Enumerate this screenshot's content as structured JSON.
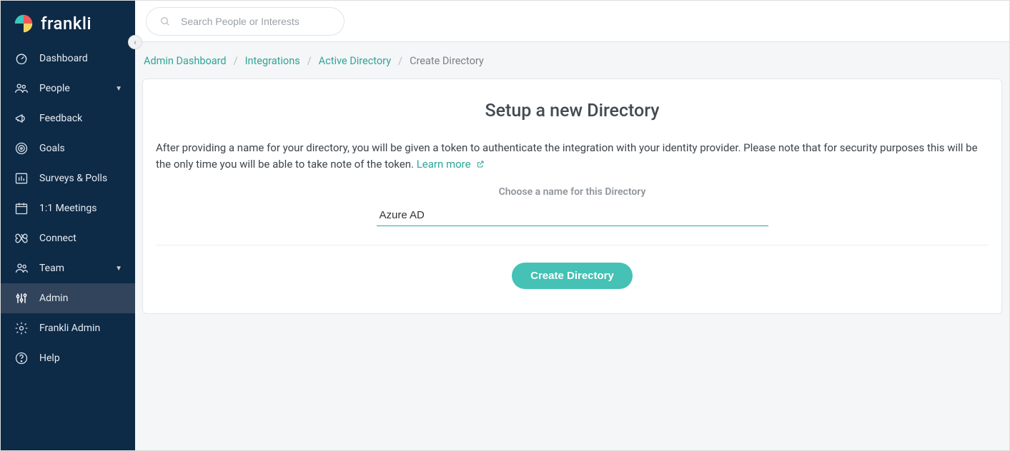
{
  "brand": {
    "name": "frankli"
  },
  "search": {
    "placeholder": "Search People or Interests"
  },
  "sidebar": {
    "items": [
      {
        "label": "Dashboard",
        "icon": "gauge-icon",
        "expandable": false
      },
      {
        "label": "People",
        "icon": "people-icon",
        "expandable": true
      },
      {
        "label": "Feedback",
        "icon": "megaphone-icon",
        "expandable": false
      },
      {
        "label": "Goals",
        "icon": "target-icon",
        "expandable": false
      },
      {
        "label": "Surveys & Polls",
        "icon": "chart-icon",
        "expandable": false
      },
      {
        "label": "1:1 Meetings",
        "icon": "calendar-icon",
        "expandable": false
      },
      {
        "label": "Connect",
        "icon": "infinity-icon",
        "expandable": false
      },
      {
        "label": "Team",
        "icon": "team-icon",
        "expandable": true
      },
      {
        "label": "Admin",
        "icon": "sliders-icon",
        "expandable": false,
        "active": true
      },
      {
        "label": "Frankli Admin",
        "icon": "gear-icon",
        "expandable": false
      },
      {
        "label": "Help",
        "icon": "help-icon",
        "expandable": false
      }
    ]
  },
  "breadcrumbs": {
    "items": [
      {
        "label": "Admin Dashboard",
        "link": true
      },
      {
        "label": "Integrations",
        "link": true
      },
      {
        "label": "Active Directory",
        "link": true
      },
      {
        "label": "Create Directory",
        "link": false
      }
    ]
  },
  "page": {
    "title": "Setup a new Directory",
    "description": "After providing a name for your directory, you will be given a token to authenticate the integration with your identity provider. Please note that for security purposes this will be the only time you will be able to take note of the token.",
    "learn_more_label": "Learn more",
    "field_label": "Choose a name for this Directory",
    "field_value": "Azure AD",
    "submit_label": "Create Directory"
  }
}
